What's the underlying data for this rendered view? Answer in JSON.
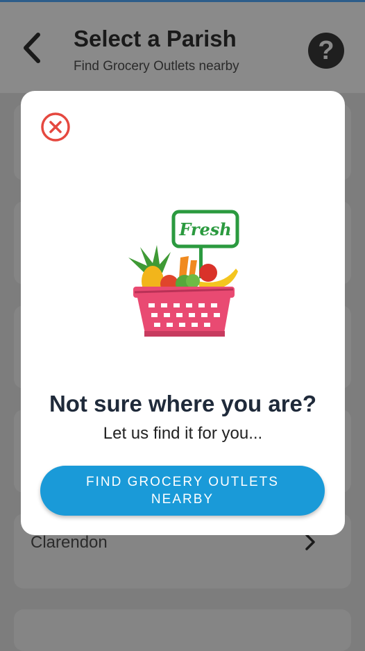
{
  "header": {
    "title": "Select a Parish",
    "subtitle": "Find Grocery Outlets nearby",
    "help_symbol": "?"
  },
  "list": {
    "visible_item_label": "Clarendon"
  },
  "modal": {
    "illustration_sign_text": "Fresh",
    "heading": "Not sure where you are?",
    "subheading": "Let us find it for you...",
    "cta_label": "FIND GROCERY OUTLETS NEARBY"
  },
  "colors": {
    "accent": "#1a9ad8",
    "close": "#e5483f",
    "basket": "#e94a72",
    "sign": "#2b9a3f"
  }
}
